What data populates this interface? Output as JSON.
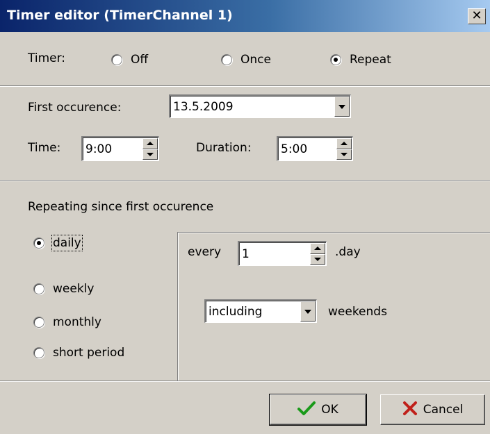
{
  "window": {
    "title": "Timer editor (TimerChannel 1)",
    "close_glyph": "✕"
  },
  "timer": {
    "label": "Timer:",
    "options": [
      "Off",
      "Once",
      "Repeat"
    ],
    "selected": "Repeat"
  },
  "schedule": {
    "first_occurence_label": "First occurence:",
    "first_occurence_value": "13.5.2009",
    "time_label": "Time:",
    "time_value": "9:00",
    "duration_label": "Duration:",
    "duration_value": "5:00"
  },
  "repeating": {
    "header": "Repeating since first occurence",
    "modes": [
      "daily",
      "weekly",
      "monthly",
      "short period"
    ],
    "selected_mode": "daily",
    "every_label": "every",
    "every_value": "1",
    "day_suffix": ".day",
    "weekends_option": "including",
    "weekends_label": "weekends"
  },
  "buttons": {
    "ok_label": "OK",
    "cancel_label": "Cancel"
  },
  "colors": {
    "title_bar_start": "#0a246a",
    "title_bar_end": "#a6caf0",
    "dialog_bg": "#d4d0c8",
    "ok_icon": "#1a9a1a",
    "cancel_icon": "#c0201a"
  },
  "icons": {
    "close": "close-icon",
    "ok": "checkmark-icon",
    "cancel": "x-mark-icon",
    "dropdown": "chevron-down-icon",
    "spin": "spinner-arrows-icon"
  }
}
